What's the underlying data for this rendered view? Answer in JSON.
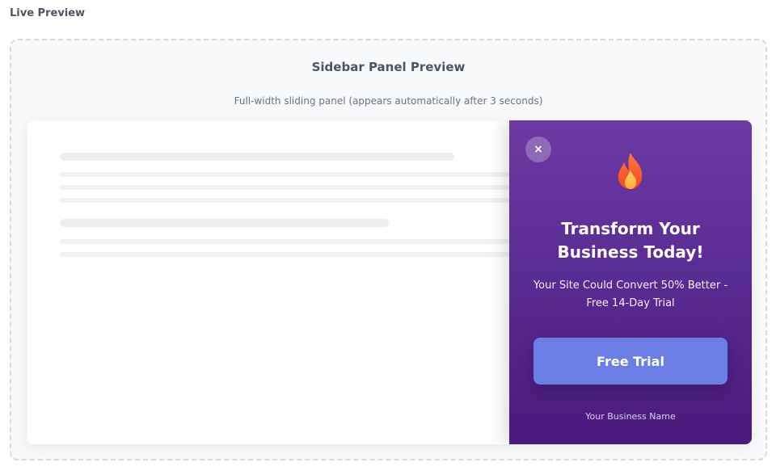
{
  "section": {
    "title": "Live Preview"
  },
  "preview": {
    "title": "Sidebar Panel Preview",
    "subtitle": "Full-width sliding panel (appears automatically after 3 seconds)"
  },
  "panel": {
    "close_icon": "close-icon",
    "close_glyph": "×",
    "emoji_icon": "fire-icon",
    "headline": "Transform Your Business Today!",
    "subline": "Your Site Could Convert 50% Better - Free 14-Day Trial",
    "cta_label": "Free Trial",
    "brand": "Your Business Name"
  },
  "colors": {
    "panel_top": "#6c3aa2",
    "panel_bottom": "#4a1a7c",
    "cta": "#6b7ee6"
  }
}
